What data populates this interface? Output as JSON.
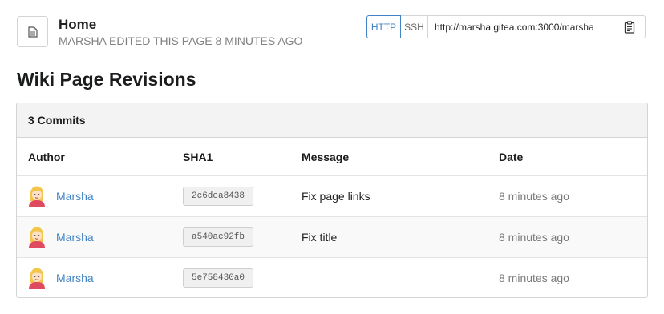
{
  "wiki": {
    "title": "Home",
    "edit_info": "MARSHA EDITED THIS PAGE 8 MINUTES AGO"
  },
  "clone": {
    "http_label": "HTTP",
    "ssh_label": "SSH",
    "url": "http://marsha.gitea.com:3000/marsha"
  },
  "section_title": "Wiki Page Revisions",
  "revisions": {
    "commit_count": "3 Commits",
    "columns": {
      "author": "Author",
      "sha": "SHA1",
      "message": "Message",
      "date": "Date"
    },
    "rows": [
      {
        "author": "Marsha",
        "sha": "2c6dca8438",
        "message": "Fix page links",
        "date": "8 minutes ago"
      },
      {
        "author": "Marsha",
        "sha": "a540ac92fb",
        "message": "Fix title",
        "date": "8 minutes ago"
      },
      {
        "author": "Marsha",
        "sha": "5e758430a0",
        "message": "",
        "date": "8 minutes ago"
      }
    ]
  },
  "icons": {
    "page": "file-text-icon",
    "copy": "clipboard-icon",
    "avatar": "user-avatar-icon"
  },
  "colors": {
    "link": "#4183c4",
    "header_bg": "#f3f3f3",
    "alt_row_bg": "#f9f9f9"
  }
}
